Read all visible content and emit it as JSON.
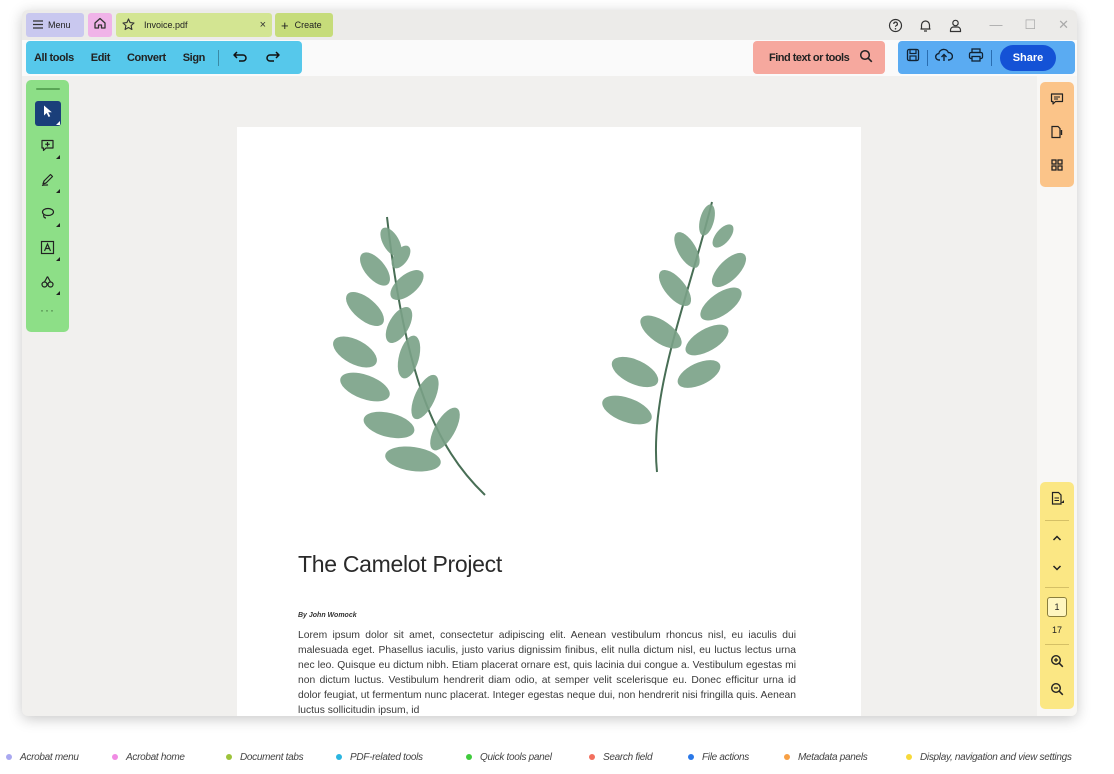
{
  "titlebar": {
    "menu_label": "Menu",
    "tab_name": "Invoice.pdf",
    "tab_close": "×",
    "create_label": "Create",
    "min": "—",
    "max": "☐",
    "close": "✕"
  },
  "pdf_tools": {
    "items": [
      "All tools",
      "Edit",
      "Convert",
      "Sign"
    ]
  },
  "search": {
    "label": "Find text or tools"
  },
  "file_actions": {
    "share_label": "Share"
  },
  "quick_tools": {
    "icons": [
      "cursor-icon",
      "add-comment-icon",
      "draw-icon",
      "lasso-icon",
      "text-box-icon",
      "stamp-icon"
    ],
    "more": "···"
  },
  "display_panel": {
    "current_page": "1",
    "total_pages": "17"
  },
  "document": {
    "title": "The Camelot Project",
    "byline": "By John Womock",
    "body": "Lorem ipsum dolor sit amet, consectetur adipiscing elit. Aenean vestibulum rhoncus nisl, eu iaculis dui malesuada eget. Phasellus iaculis, justo varius dignissim finibus, elit nulla dictum nisl, eu luctus lectus urna nec leo. Quisque eu dictum nibh. Etiam placerat ornare est, quis lacinia dui congue a. Vestibulum egestas mi non dictum luctus. Vestibulum hendrerit diam odio, at semper velit scelerisque eu. Donec efficitur urna id dolor feugiat, ut fermentum nunc placerat. Integer egestas neque dui, non hendrerit nisi fringilla quis. Aenean luctus sollicitudin ipsum, id"
  },
  "legend": [
    {
      "label": "Acrobat menu",
      "color": "#a9a8f0"
    },
    {
      "label": "Acrobat home",
      "color": "#f08be3"
    },
    {
      "label": "Document tabs",
      "color": "#9dc33b"
    },
    {
      "label": "PDF-related tools",
      "color": "#2bb5e0"
    },
    {
      "label": "Quick tools panel",
      "color": "#3fcb3c"
    },
    {
      "label": "Search field",
      "color": "#f26f5e"
    },
    {
      "label": "File actions",
      "color": "#2a78e8"
    },
    {
      "label": "Metadata panels",
      "color": "#f7a045"
    },
    {
      "label": "Display, navigation and view settings",
      "color": "#f7d93a"
    }
  ]
}
